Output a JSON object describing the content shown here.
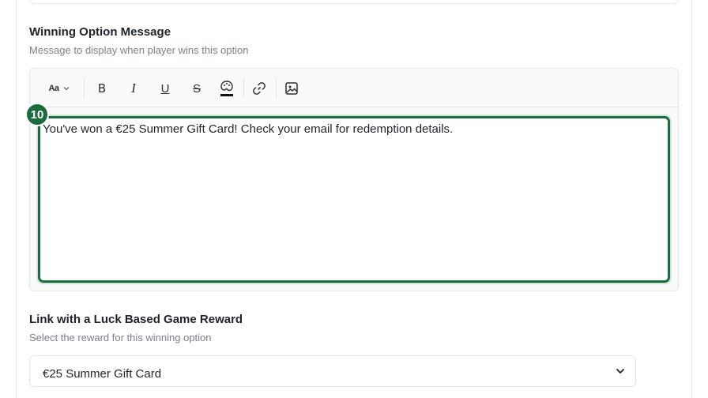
{
  "winning_message": {
    "label": "Winning Option Message",
    "description": "Message to display when player wins this option",
    "toolbar": {
      "font_size_label": "Aa",
      "bold_label": "B",
      "italic_label": "I",
      "underline_label": "U",
      "strikethrough_label": "S"
    },
    "content": "You've won a €25 Summer Gift Card! Check your email for redemption details.",
    "step_badge": "10"
  },
  "reward_link": {
    "label": "Link with a Luck Based Game Reward",
    "description": "Select the reward for this winning option",
    "selected_value": "€25 Summer Gift Card"
  },
  "colors": {
    "accent": "#1b6b3e",
    "border": "#e5e7eb",
    "muted_text": "#7b8089"
  },
  "icons": [
    "chevron-down-icon",
    "bold-icon",
    "italic-icon",
    "underline-icon",
    "strikethrough-icon",
    "palette-icon",
    "link-icon",
    "image-icon"
  ]
}
